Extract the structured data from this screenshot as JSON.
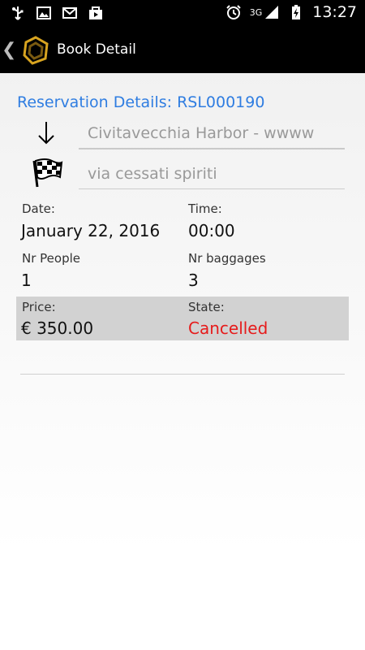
{
  "status_bar": {
    "time": "13:27",
    "network_label": "3G",
    "icons": [
      "usb-icon",
      "gallery-icon",
      "mail-icon",
      "store-icon",
      "alarm-icon",
      "signal-icon",
      "battery-icon"
    ]
  },
  "action_bar": {
    "title": "Book Detail",
    "back_icon": "chevron-left-icon",
    "logo_icon": "app-logo-icon"
  },
  "reservation": {
    "title": "Reservation Details: RSL000190",
    "pickup_value": "Civitavecchia Harbor - wwww",
    "dropoff_value": "via cessati spiriti",
    "date_label": "Date:",
    "date_value": "January 22, 2016",
    "time_label": "Time:",
    "time_value": "00:00",
    "people_label": "Nr People",
    "people_value": "1",
    "baggages_label": "Nr baggages",
    "baggages_value": "3",
    "price_label": "Price:",
    "price_value": "€ 350.00",
    "state_label": "State:",
    "state_value": "Cancelled"
  },
  "colors": {
    "accent": "#2f7de1",
    "cancelled": "#e61b1b",
    "price_row_bg": "#d2d2d2"
  }
}
